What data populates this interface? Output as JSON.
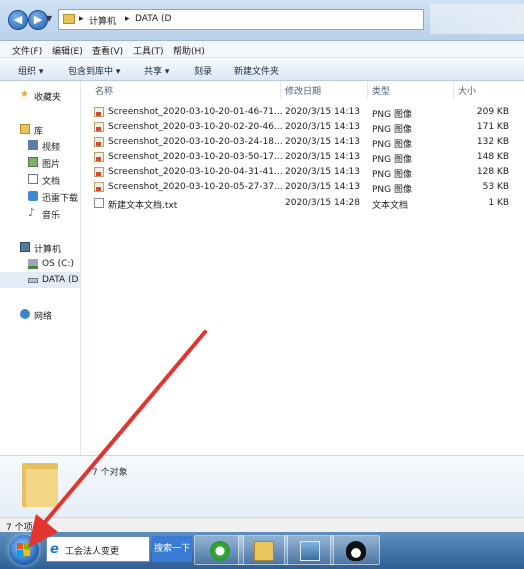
{
  "address": {
    "crumbs": [
      "计算机",
      "DATA (D"
    ],
    "sep": "▸"
  },
  "menu": [
    "文件(F)",
    "编辑(E)",
    "查看(V)",
    "工具(T)",
    "帮助(H)"
  ],
  "toolbar": [
    "组织 ▾",
    "包含到库中 ▾",
    "共享 ▾",
    "刻录",
    "新建文件夹"
  ],
  "nav": {
    "favorites": "收藏夹",
    "libraries": "库",
    "lib_items": [
      "视频",
      "图片",
      "文档",
      "迅雷下载",
      "音乐"
    ],
    "computer": "计算机",
    "drives": [
      "OS (C:)",
      "DATA (D"
    ],
    "network": "网络"
  },
  "columns": {
    "name": "名称",
    "date": "修改日期",
    "type": "类型",
    "size": "大小"
  },
  "files": [
    {
      "name": "Screenshot_2020-03-10-20-01-46-71...",
      "date": "2020/3/15 14:13",
      "type": "PNG 图像",
      "size": "209 KB",
      "icon": "png-icon"
    },
    {
      "name": "Screenshot_2020-03-10-20-02-20-46...",
      "date": "2020/3/15 14:13",
      "type": "PNG 图像",
      "size": "171 KB",
      "icon": "png-icon"
    },
    {
      "name": "Screenshot_2020-03-10-20-03-24-18...",
      "date": "2020/3/15 14:13",
      "type": "PNG 图像",
      "size": "132 KB",
      "icon": "png-icon"
    },
    {
      "name": "Screenshot_2020-03-10-20-03-50-17...",
      "date": "2020/3/15 14:13",
      "type": "PNG 图像",
      "size": "148 KB",
      "icon": "png-icon"
    },
    {
      "name": "Screenshot_2020-03-10-20-04-31-41...",
      "date": "2020/3/15 14:13",
      "type": "PNG 图像",
      "size": "128 KB",
      "icon": "png-icon"
    },
    {
      "name": "Screenshot_2020-03-10-20-05-27-37...",
      "date": "2020/3/15 14:13",
      "type": "PNG 图像",
      "size": "53 KB",
      "icon": "png-icon"
    },
    {
      "name": "新建文本文档.txt",
      "date": "2020/3/15 14:28",
      "type": "文本文档",
      "size": "1 KB",
      "icon": "txt-icon"
    }
  ],
  "details": {
    "count": "7 个对象"
  },
  "status": {
    "text": "7 个项"
  },
  "taskbar": {
    "search_value": "工会法人变更",
    "search_button": "搜索一下",
    "apps": [
      "ie-icon",
      "explorer-icon",
      "screenshot-icon",
      "qq-icon"
    ]
  },
  "colors": {
    "accent": "#3a7bd5",
    "arrow": "#e3342f",
    "taskbar": "#2f5f93"
  }
}
